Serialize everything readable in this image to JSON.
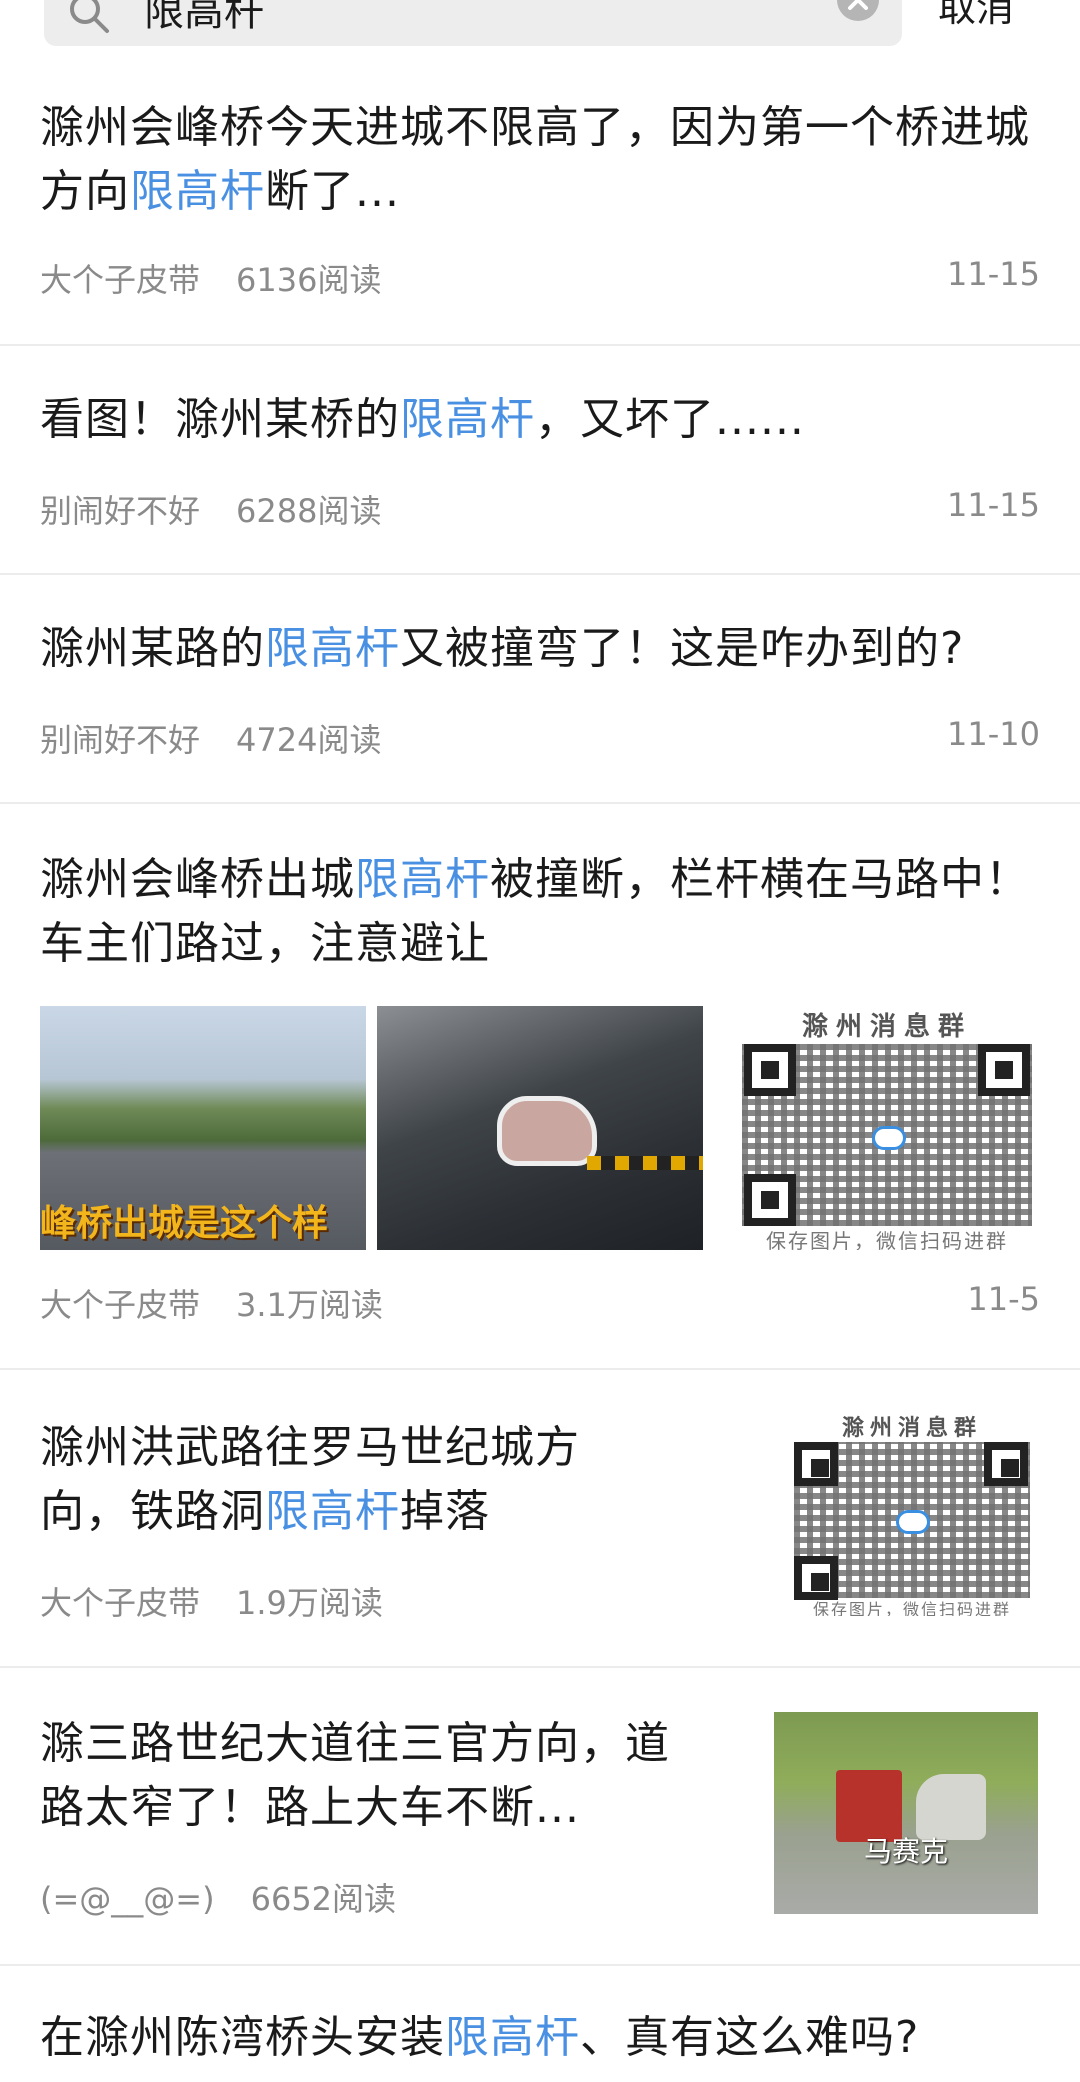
{
  "search": {
    "query": "限高杆",
    "cancel_label": "取消"
  },
  "results": [
    {
      "title_parts": [
        "滁州会峰桥今天进城不限高了，因为第一个桥进城方向",
        "限高杆",
        "断了..."
      ],
      "author": "大个子皮带",
      "reads": "6136阅读",
      "date": "11-15"
    },
    {
      "title_parts": [
        "看图！滁州某桥的",
        "限高杆",
        "，又坏了......"
      ],
      "author": "别闹好不好",
      "reads": "6288阅读",
      "date": "11-15"
    },
    {
      "title_parts": [
        "滁州某路的",
        "限高杆",
        "又被撞弯了！这是咋办到的?"
      ],
      "author": "别闹好不好",
      "reads": "4724阅读",
      "date": "11-10"
    },
    {
      "title_parts": [
        "滁州会峰桥出城",
        "限高杆",
        "被撞断，栏杆横在马路中！车主们路过，注意避让"
      ],
      "author": "大个子皮带",
      "reads": "3.1万阅读",
      "date": "11-5",
      "image_caption": "峰桥出城是这个样",
      "qr_title": "滁州消息群",
      "qr_footer": "保存图片，微信扫码进群"
    },
    {
      "title_parts": [
        "滁州洪武路往罗马世纪城方向，铁路洞",
        "限高杆",
        "掉落"
      ],
      "author": "大个子皮带",
      "reads": "1.9万阅读",
      "qr_title": "滁州消息群",
      "qr_footer": "保存图片，微信扫码进群"
    },
    {
      "title_parts": [
        "滁三路世纪大道往三官方向，道路太窄了！路上大车不断..."
      ],
      "author": "(=@__@=)",
      "reads": "6652阅读",
      "image_watermark": "马赛克"
    },
    {
      "title_parts": [
        "在滁州陈湾桥头安装",
        "限高杆",
        "、真有这么难吗?"
      ]
    }
  ],
  "colors": {
    "highlight": "#4a90e2",
    "meta": "#8a8a8a",
    "divider": "#ececec"
  }
}
